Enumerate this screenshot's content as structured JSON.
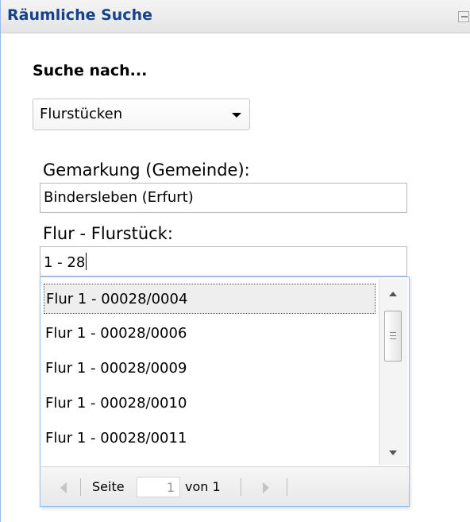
{
  "panel": {
    "title": "Räumliche Suche"
  },
  "search": {
    "heading": "Suche nach...",
    "type_value": "Flurstücken"
  },
  "fields": {
    "gemarkung_label": "Gemarkung (Gemeinde):",
    "gemarkung_value": "Bindersleben (Erfurt)",
    "flur_label": "Flur - Flurstück:",
    "flur_value": "1 - 28"
  },
  "results": {
    "items": [
      "Flur 1 - 00028/0004",
      "Flur 1 - 00028/0006",
      "Flur 1 - 00028/0009",
      "Flur 1 - 00028/0010",
      "Flur 1 - 00028/0011"
    ],
    "selected_index": 0
  },
  "pager": {
    "page_label": "Seite",
    "page_value": "1",
    "of_label": "von 1"
  }
}
